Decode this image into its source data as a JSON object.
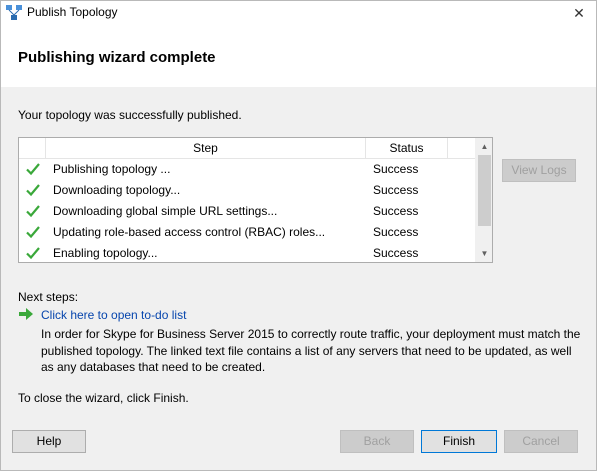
{
  "window": {
    "title": "Publish Topology",
    "close_glyph": "✕",
    "icon": "topology-app-icon"
  },
  "header": {
    "title": "Publishing wizard complete"
  },
  "main": {
    "result_text": "Your topology was successfully published.",
    "grid": {
      "columns": [
        "Step",
        "Status"
      ],
      "rows": [
        {
          "step": "Publishing topology ...",
          "status": "Success",
          "icon": "success-check-icon"
        },
        {
          "step": "Downloading topology...",
          "status": "Success",
          "icon": "success-check-icon"
        },
        {
          "step": "Downloading global simple URL settings...",
          "status": "Success",
          "icon": "success-check-icon"
        },
        {
          "step": "Updating role-based access control (RBAC) roles...",
          "status": "Success",
          "icon": "success-check-icon"
        },
        {
          "step": "Enabling topology...",
          "status": "Success",
          "icon": "success-check-icon"
        }
      ]
    },
    "view_logs_label": "View Logs",
    "next_steps_label": "Next steps:",
    "todo_link": "Click here to open to-do list",
    "description": "In order for Skype for Business Server 2015 to correctly route traffic, your deployment must match the published topology. The linked text file contains a list of any servers that need to be updated, as well as any databases that need to be created.",
    "close_hint": "To close the wizard, click Finish."
  },
  "footer": {
    "help_label": "Help",
    "back_label": "Back",
    "finish_label": "Finish",
    "cancel_label": "Cancel"
  },
  "colors": {
    "check_green": "#3aa83a",
    "link_blue": "#0645ad",
    "panel_bg": "#f0f0f0",
    "focus_border": "#0078d7"
  }
}
